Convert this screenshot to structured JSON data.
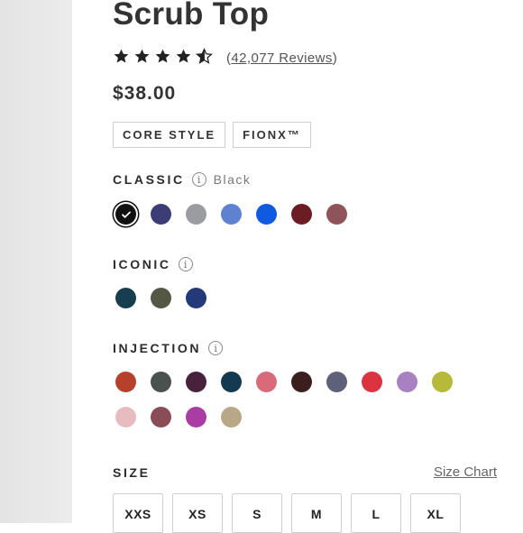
{
  "product": {
    "title": "Scrub Top",
    "rating_stars": 4.5,
    "reviews_text": "42,077 Reviews",
    "price": "$38.00",
    "tags": [
      "CORE STYLE",
      "FIONX™"
    ]
  },
  "classic": {
    "label": "CLASSIC",
    "selected_name": "Black",
    "colors": [
      "#111111",
      "#3c3d75",
      "#9b9ca2",
      "#5e82d0",
      "#0f5ae0",
      "#6c1d24",
      "#8f535a"
    ],
    "selected_index": 0
  },
  "iconic": {
    "label": "ICONIC",
    "colors": [
      "#163e4f",
      "#545744",
      "#23397a"
    ]
  },
  "injection": {
    "label": "INJECTION",
    "colors": [
      "#b5412d",
      "#4a5250",
      "#48223d",
      "#143a52",
      "#d86a7a",
      "#3a1f1e",
      "#5f6079",
      "#dc3340",
      "#a781c2",
      "#b7b93a",
      "#e7bcc0",
      "#8a4d58",
      "#a93da4",
      "#b8a887"
    ]
  },
  "size": {
    "label": "SIZE",
    "chart_link": "Size Chart",
    "options": [
      "XXS",
      "XS",
      "S",
      "M",
      "L",
      "XL"
    ]
  },
  "icons": {
    "star": "star-icon",
    "info": "info-icon",
    "check": "check-icon"
  }
}
